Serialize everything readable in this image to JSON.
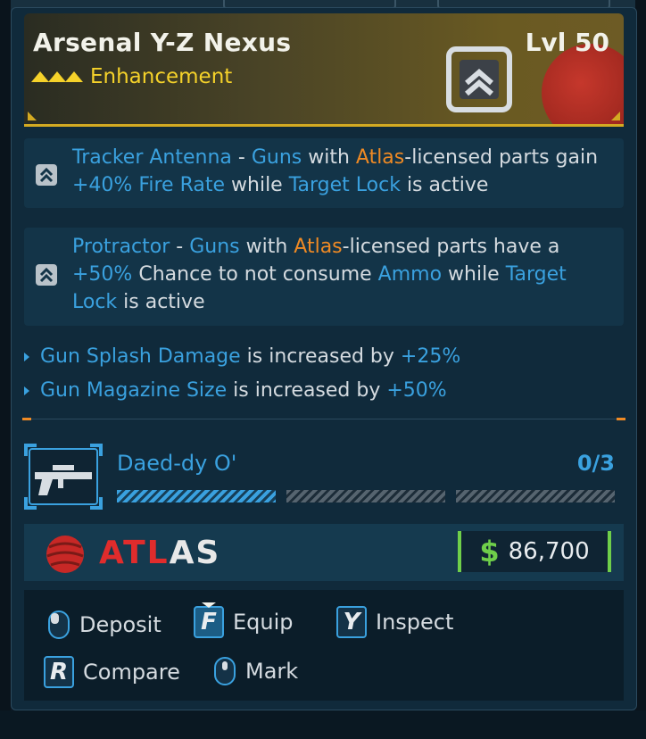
{
  "item": {
    "name": "Arsenal Y-Z Nexus",
    "level": "Lvl 50",
    "type": "Enhancement"
  },
  "perks": [
    {
      "name": "Tracker Antenna",
      "sep": " - ",
      "t1": "Guns",
      "t2": " with ",
      "t3": "Atlas",
      "t4": "-licensed parts gain ",
      "t5": "+40% Fire Rate",
      "t6": " while ",
      "t7": "Target Lock",
      "t8": " is active"
    },
    {
      "name": "Protractor",
      "sep": " - ",
      "t1": "Guns",
      "t2": " with ",
      "t3": "Atlas",
      "t4": "-licensed parts have a ",
      "t5": "+50%",
      "t6": " Chance to not consume ",
      "t7": "Ammo",
      "t8": " while ",
      "t9": "Target Lock",
      "t10": " is active"
    }
  ],
  "stats": [
    {
      "name": "Gun Splash Damage",
      "mid": " is increased by ",
      "value": "+25%"
    },
    {
      "name": "Gun Magazine Size",
      "mid": " is increased by ",
      "value": "+50%"
    }
  ],
  "attachment": {
    "name": "Daed-dy O'",
    "slots": "0/3",
    "slot_fill": [
      1,
      0,
      0
    ]
  },
  "manufacturer": {
    "name_part1": "ATL",
    "name_part2": "AS"
  },
  "price": {
    "currency": "$",
    "amount": "86,700"
  },
  "actions": {
    "deposit": "Deposit",
    "equip_key": "F",
    "equip": "Equip",
    "inspect_key": "Y",
    "inspect": "Inspect",
    "compare_key": "R",
    "compare": "Compare",
    "mark": "Mark"
  },
  "colors": {
    "accent_blue": "#3aa1df",
    "accent_orange": "#ef8a24",
    "rarity_gold": "#d3aa22",
    "money_green": "#6fcf4a",
    "brand_red": "#e02c2c"
  }
}
